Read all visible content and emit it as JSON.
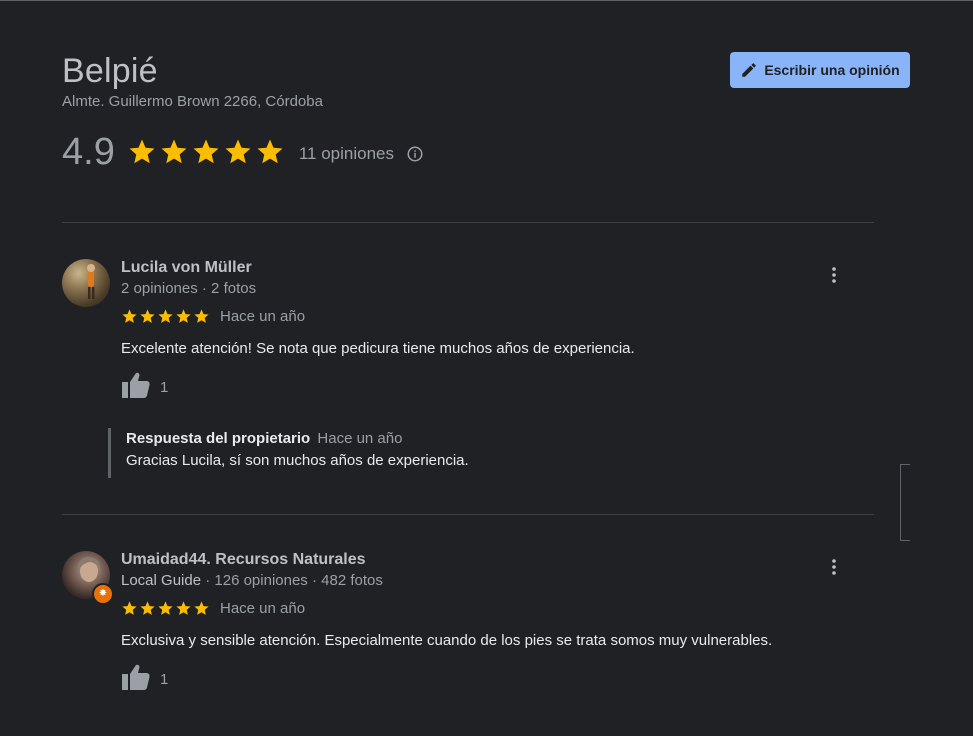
{
  "place": {
    "title": "Belpié",
    "address": "Almte. Guillermo Brown 2266, Córdoba",
    "rating": "4.9",
    "review_count_label": "11 opiniones",
    "write_review_label": "Escribir una opinión"
  },
  "reviews": [
    {
      "name": "Lucila von Müller",
      "meta": "2 opiniones · 2 fotos",
      "stars": 5,
      "date": "Hace un año",
      "text": "Excelente atención! Se nota que pedicura tiene muchos años de experiencia.",
      "likes": "1",
      "owner_reply": {
        "label": "Respuesta del propietario",
        "date": "Hace un año",
        "text": "Gracias Lucila, sí son muchos años de experiencia."
      }
    },
    {
      "name": "Umaidad44. Recursos Naturales",
      "badge": "Local Guide",
      "meta": " · 126 opiniones · 482 fotos",
      "stars": 5,
      "date": "Hace un año",
      "text": "Exclusiva y sensible atención. Especialmente  cuando de los pies se trata somos muy vulnerables.",
      "likes": "1"
    }
  ],
  "colors": {
    "background": "#202124",
    "star": "#fbbc04",
    "button": "#8ab4f8",
    "guide_badge": "#e8710a"
  },
  "icons": [
    "pencil-icon",
    "star-icon",
    "info-icon",
    "more-vert-icon",
    "thumb-up-icon",
    "local-guide-icon"
  ]
}
